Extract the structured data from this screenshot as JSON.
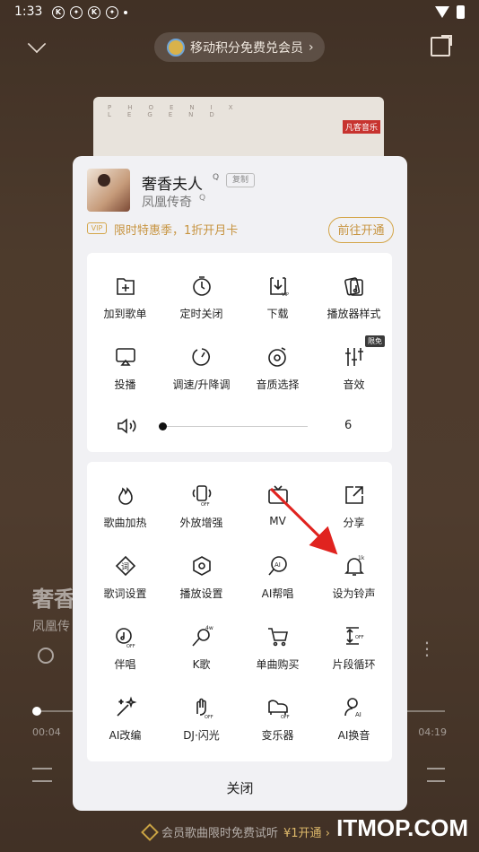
{
  "status_bar": {
    "time": "1:33",
    "icons": [
      "K",
      "✦",
      "K",
      "✦"
    ]
  },
  "top": {
    "promo_text": "移动积分免费兑会员",
    "promo_chevron": "›"
  },
  "album": {
    "letters": "PHOENIX LEGEND",
    "logo": "凡客音乐"
  },
  "player": {
    "title": "奢香",
    "artist": "凤凰传",
    "time_current": "00:04",
    "time_total": "04:19",
    "bottom_promo": "会员歌曲限时免费试听",
    "bottom_cta": "¥1开通 ›"
  },
  "sheet": {
    "song_title": "奢香夫人",
    "artist": "凤凰传奇",
    "q_mark": "Q",
    "copy_label": "复制",
    "vip_badge": "VIP",
    "vip_text": "限时特惠季，1折开月卡",
    "vip_button": "前往开通",
    "card1_items": [
      {
        "name": "add-to-playlist",
        "label": "加到歌单",
        "icon": "folder-plus-icon"
      },
      {
        "name": "sleep-timer",
        "label": "定时关闭",
        "icon": "timer-icon"
      },
      {
        "name": "download",
        "label": "下载",
        "icon": "download-vip-icon"
      },
      {
        "name": "player-style",
        "label": "播放器样式",
        "icon": "player-skin-icon"
      },
      {
        "name": "cast",
        "label": "投播",
        "icon": "cast-icon"
      },
      {
        "name": "speed-pitch",
        "label": "调速/升降调",
        "icon": "speed-dial-icon"
      },
      {
        "name": "quality",
        "label": "音质选择",
        "icon": "disc-icon"
      },
      {
        "name": "sound-effect",
        "label": "音效",
        "icon": "equalizer-icon"
      }
    ],
    "limited_badge": "限免",
    "volume": {
      "value": "6",
      "level": 0.03
    },
    "card2_items": [
      {
        "name": "song-boost",
        "label": "歌曲加热",
        "icon": "flame-icon"
      },
      {
        "name": "speaker-boost",
        "label": "外放增强",
        "icon": "phone-speaker-icon"
      },
      {
        "name": "mv",
        "label": "MV",
        "icon": "tv-icon"
      },
      {
        "name": "share",
        "label": "分享",
        "icon": "share-icon"
      },
      {
        "name": "lyric-settings",
        "label": "歌词设置",
        "icon": "lyric-icon"
      },
      {
        "name": "play-settings",
        "label": "播放设置",
        "icon": "hexagon-settings-icon"
      },
      {
        "name": "ai-sing",
        "label": "AI帮唱",
        "icon": "ai-mic-icon"
      },
      {
        "name": "set-ringtone",
        "label": "设为铃声",
        "icon": "bell-icon"
      },
      {
        "name": "accompaniment",
        "label": "伴唱",
        "icon": "accompany-icon"
      },
      {
        "name": "karaoke",
        "label": "K歌",
        "icon": "mic-icon"
      },
      {
        "name": "single-purchase",
        "label": "单曲购买",
        "icon": "cart-icon"
      },
      {
        "name": "segment-loop",
        "label": "片段循环",
        "icon": "loop-segment-icon"
      },
      {
        "name": "ai-remix",
        "label": "AI改编",
        "icon": "magic-wand-icon"
      },
      {
        "name": "dj-flash",
        "label": "DJ·闪光",
        "icon": "hand-icon"
      },
      {
        "name": "instrument-change",
        "label": "变乐器",
        "icon": "piano-icon"
      },
      {
        "name": "ai-voice-swap",
        "label": "AI换音",
        "icon": "ai-voice-icon"
      }
    ],
    "badges": {
      "ringtone": "1k",
      "karaoke": "4w",
      "off": "OFF"
    },
    "close_label": "关闭"
  },
  "watermark": "ITMOP.COM",
  "colors": {
    "accent_gold": "#c79440",
    "arrow_red": "#e0231f"
  }
}
